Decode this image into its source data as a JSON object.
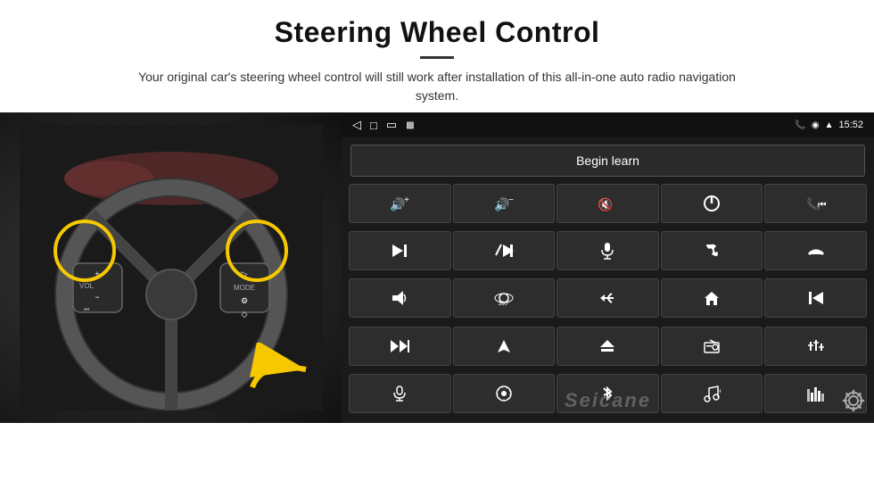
{
  "header": {
    "title": "Steering Wheel Control",
    "description": "Your original car's steering wheel control will still work after installation of this all-in-one auto radio navigation system."
  },
  "status_bar": {
    "back_icon": "◁",
    "home_icon": "□",
    "recent_icon": "▭",
    "signal_icon": "▩",
    "phone_icon": "📞",
    "location_icon": "◉",
    "wifi_icon": "▲",
    "time": "15:52"
  },
  "begin_learn": {
    "label": "Begin learn"
  },
  "controls": [
    {
      "icon": "🔊+",
      "label": "vol-up"
    },
    {
      "icon": "🔊−",
      "label": "vol-down"
    },
    {
      "icon": "🔇",
      "label": "mute"
    },
    {
      "icon": "⏻",
      "label": "power"
    },
    {
      "icon": "📞⏮",
      "label": "phone-prev"
    },
    {
      "icon": "⏭",
      "label": "next-track"
    },
    {
      "icon": "✂⏭",
      "label": "skip"
    },
    {
      "icon": "🎤",
      "label": "mic"
    },
    {
      "icon": "📞",
      "label": "phone"
    },
    {
      "icon": "↩",
      "label": "hang-up"
    },
    {
      "icon": "📢",
      "label": "speaker"
    },
    {
      "icon": "360",
      "label": "360-cam"
    },
    {
      "icon": "↺",
      "label": "back"
    },
    {
      "icon": "🏠",
      "label": "home"
    },
    {
      "icon": "⏮⏮",
      "label": "prev-track"
    },
    {
      "icon": "⏭⏭",
      "label": "fast-forward"
    },
    {
      "icon": "▶",
      "label": "nav"
    },
    {
      "icon": "⏏",
      "label": "eject"
    },
    {
      "icon": "📻",
      "label": "radio"
    },
    {
      "icon": "⚙",
      "label": "settings-eq"
    },
    {
      "icon": "🎤",
      "label": "voice"
    },
    {
      "icon": "⊙",
      "label": "menu"
    },
    {
      "icon": "✱",
      "label": "bluetooth"
    },
    {
      "icon": "🎵",
      "label": "music"
    },
    {
      "icon": "▊▊",
      "label": "eq"
    }
  ],
  "watermark": "Seicane",
  "gear_icon": "⚙"
}
